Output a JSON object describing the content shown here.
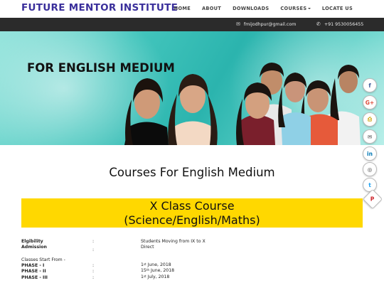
{
  "nav": {
    "brand": "FUTURE MENTOR INSTITUTE",
    "items": [
      {
        "label": "HOME"
      },
      {
        "label": "ABOUT"
      },
      {
        "label": "DOWNLOADS"
      },
      {
        "label": "COURSES"
      },
      {
        "label": "LOCATE US"
      }
    ]
  },
  "contact": {
    "email": "fmijodhpur@gmail.com",
    "phone": "+91 9530056455"
  },
  "banner": {
    "title": "FOR ENGLISH MEDIUM"
  },
  "social": {
    "icons": [
      "facebook-icon",
      "google-plus-icon",
      "print-icon",
      "email-icon",
      "linkedin-icon",
      "instagram-icon",
      "twitter-icon",
      "pinterest-icon"
    ],
    "glyphs": [
      "f",
      "G+",
      "⎙",
      "✉",
      "in",
      "◎",
      "t",
      "P"
    ]
  },
  "content": {
    "section_title": "Courses For English Medium",
    "course_line1": "X Class Course",
    "course_line2": "(Science/English/Maths)",
    "eligibility_label": "Elgibility",
    "eligibility_value": "Students Moving from IX to X",
    "admission_label": "Admission",
    "admission_value": "Direct",
    "classes_start": "Classes Start From -",
    "phases": [
      {
        "label": "PHASE - I",
        "day": "1",
        "suffix": "st",
        "rest": "June, 2018"
      },
      {
        "label": "PHASE - II",
        "day": "15",
        "suffix": "th",
        "rest": "June, 2018"
      },
      {
        "label": "PHASE - III",
        "day": "1",
        "suffix": "st",
        "rest": "July, 2018"
      }
    ],
    "colon": ":"
  },
  "colors": {
    "brand": "#3a2f9b",
    "contact_bar": "#2b2b2b",
    "highlight": "#ffd800",
    "banner_teal": "#2bb4ae"
  }
}
